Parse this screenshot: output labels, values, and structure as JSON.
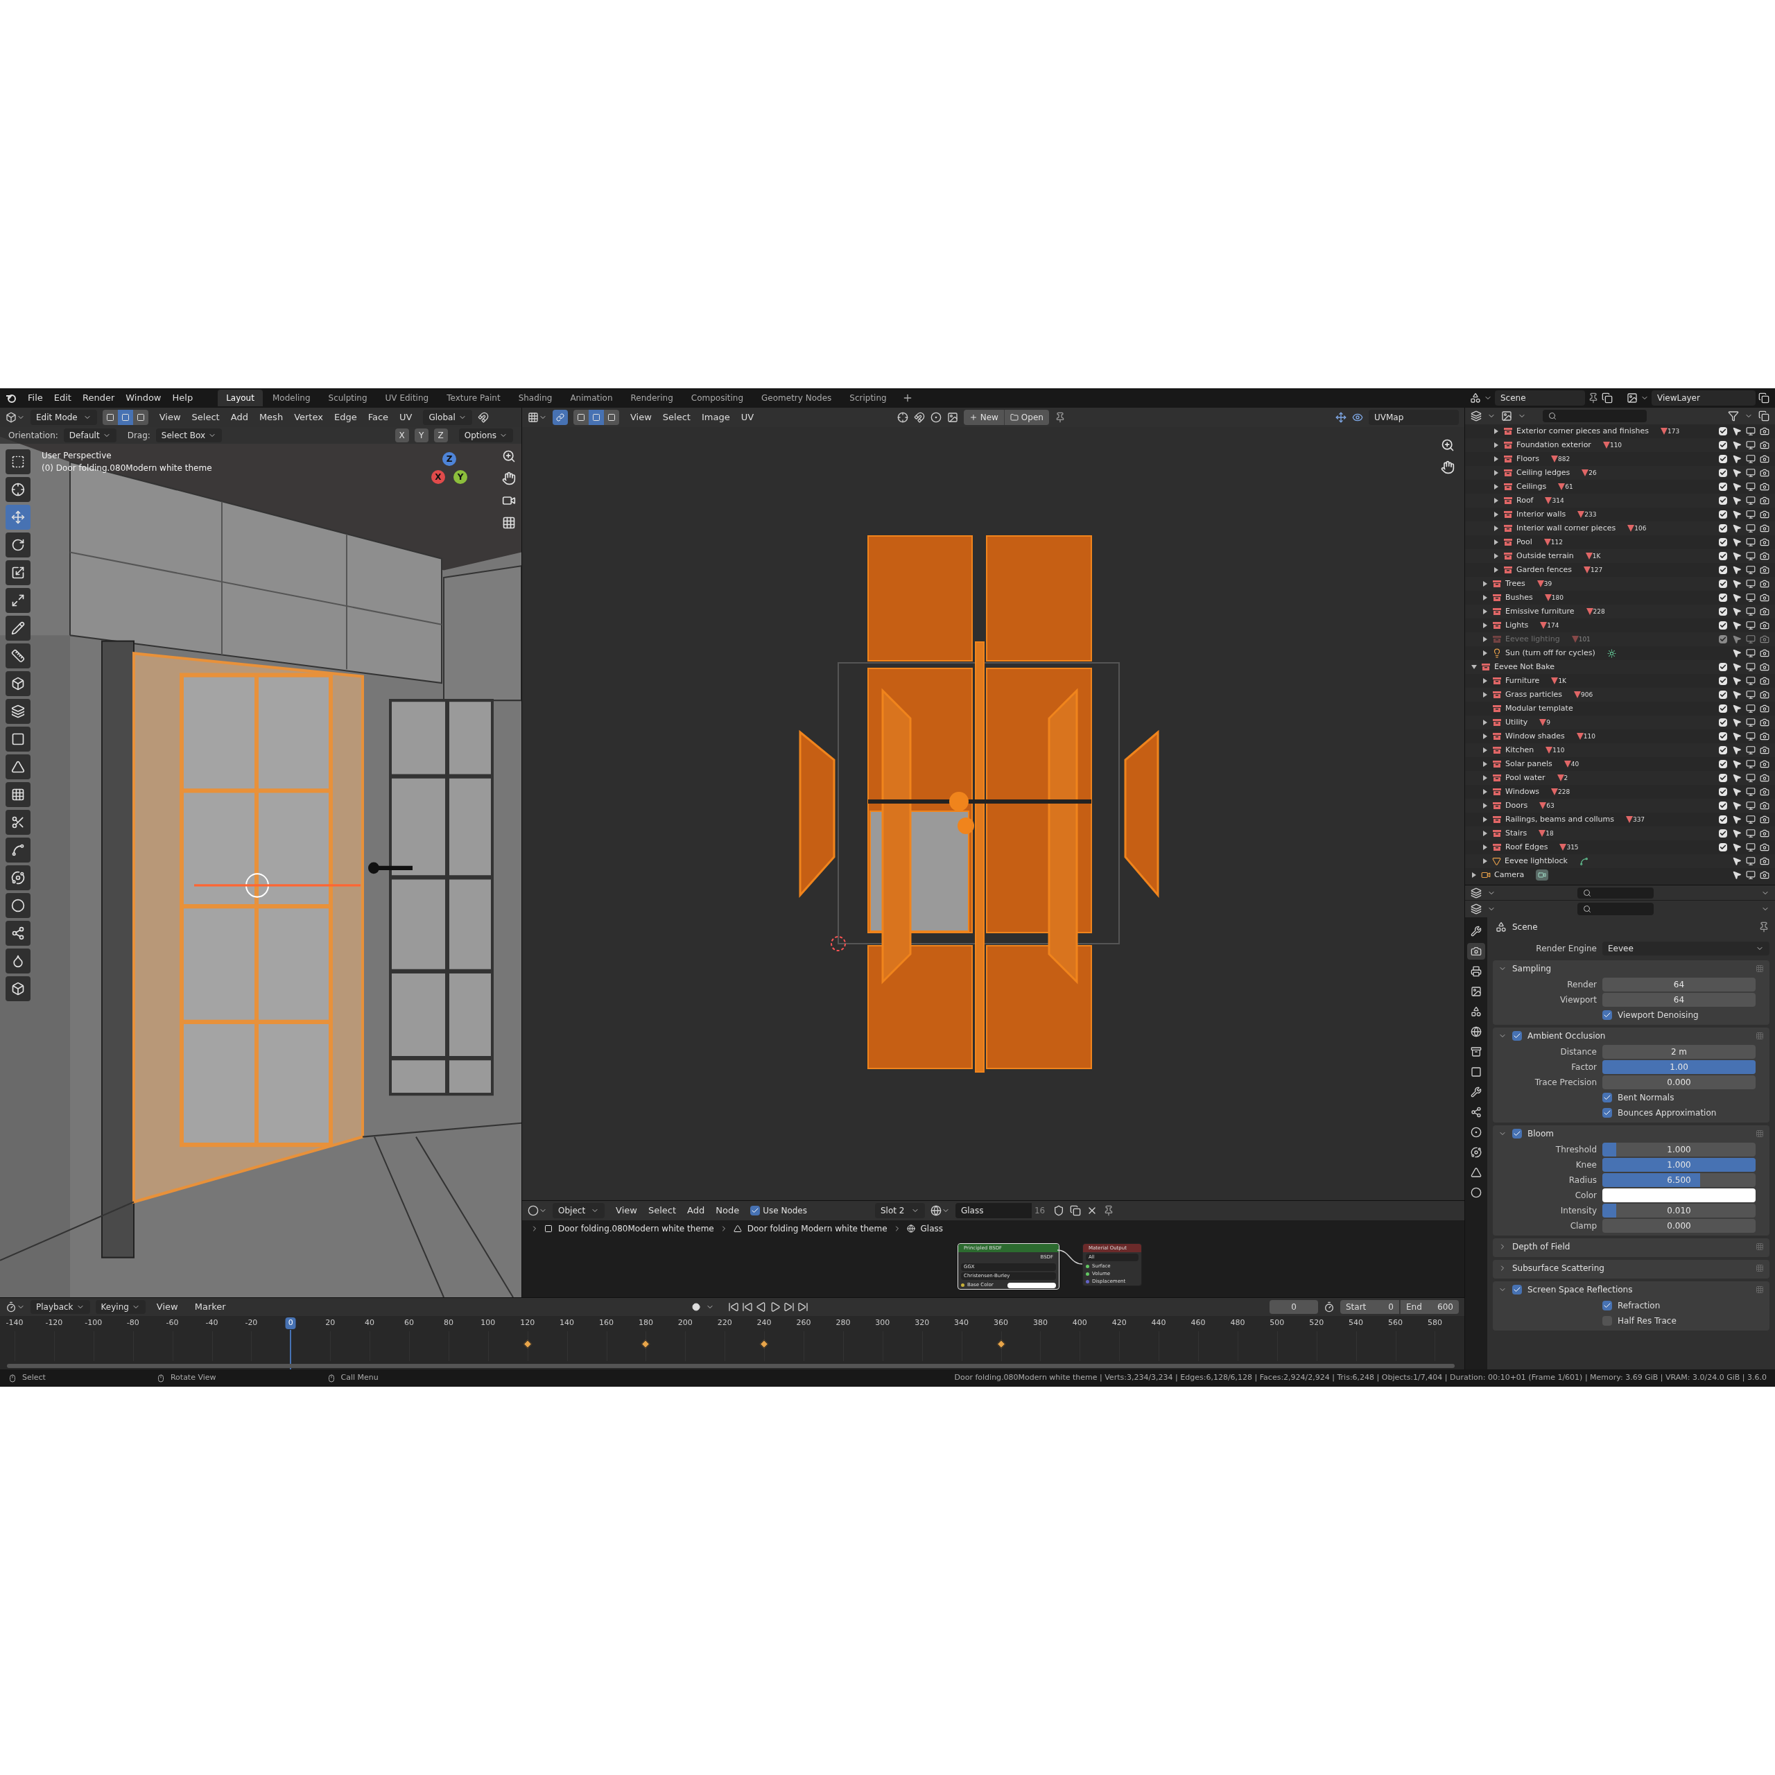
{
  "topbar": {
    "menus": [
      "File",
      "Edit",
      "Render",
      "Window",
      "Help"
    ],
    "workspaces": [
      {
        "label": "Layout",
        "selected": true
      },
      {
        "label": "Modeling",
        "selected": false
      },
      {
        "label": "Sculpting",
        "selected": false
      },
      {
        "label": "UV Editing",
        "selected": false
      },
      {
        "label": "Texture Paint",
        "selected": false
      },
      {
        "label": "Shading",
        "selected": false
      },
      {
        "label": "Animation",
        "selected": false
      },
      {
        "label": "Rendering",
        "selected": false
      },
      {
        "label": "Compositing",
        "selected": false
      },
      {
        "label": "Geometry Nodes",
        "selected": false
      },
      {
        "label": "Scripting",
        "selected": false
      }
    ],
    "scene": "Scene",
    "view_layer": "ViewLayer"
  },
  "viewport": {
    "mode": "Edit Mode",
    "select_modes": [
      {
        "selected": false
      },
      {
        "selected": true
      },
      {
        "selected": false
      }
    ],
    "menus": [
      "View",
      "Select",
      "Add",
      "Mesh",
      "Vertex",
      "Edge",
      "Face",
      "UV"
    ],
    "orientation": "Global",
    "orientation_label": "Orientation:",
    "orientation_default": "Default",
    "drag_label": "Drag:",
    "drag": "Select Box",
    "axes": [
      "X",
      "Y",
      "Z"
    ],
    "options": "Options",
    "overlay_lines": [
      "User Perspective",
      "(0) Door folding.080Modern white theme"
    ],
    "gizmo": [
      "X",
      "Y",
      "Z"
    ],
    "tools": [
      {
        "selected": false
      },
      {
        "selected": false
      },
      {
        "selected": true
      },
      {
        "selected": false
      },
      {
        "selected": false
      },
      {
        "selected": false
      },
      {
        "selected": false
      },
      {
        "selected": false
      },
      {
        "selected": false
      },
      {
        "selected": false
      },
      {
        "selected": false
      },
      {
        "selected": false
      },
      {
        "selected": false
      },
      {
        "selected": false
      },
      {
        "selected": false
      },
      {
        "selected": false
      },
      {
        "selected": false
      },
      {
        "selected": false
      },
      {
        "selected": false
      },
      {
        "selected": false
      }
    ]
  },
  "uv_editor": {
    "sync": true,
    "select_modes": [
      {
        "selected": false
      },
      {
        "selected": true
      },
      {
        "selected": false
      }
    ],
    "menus": [
      "View",
      "Select",
      "Image",
      "UV"
    ],
    "new": "New",
    "open": "Open",
    "uv_map": "UVMap"
  },
  "outliner": {
    "items": [
      {
        "children": [
          {
            "children": [
              {
                "name": "Exterior corner pieces and finishes",
                "count": "173",
                "kind": "collection",
                "expanded": false,
                "checked": true,
                "disabled": false
              },
              {
                "name": "Foundation exterior",
                "count": "110",
                "kind": "collection",
                "expanded": false,
                "checked": true,
                "disabled": false
              },
              {
                "name": "Floors",
                "count": "882",
                "kind": "collection",
                "expanded": false,
                "checked": true,
                "disabled": false
              },
              {
                "name": "Ceiling ledges",
                "count": "26",
                "kind": "collection",
                "expanded": false,
                "checked": true,
                "disabled": false
              },
              {
                "name": "Ceilings",
                "count": "61",
                "kind": "collection",
                "expanded": false,
                "checked": true,
                "disabled": false
              },
              {
                "name": "Roof",
                "count": "314",
                "kind": "collection",
                "expanded": false,
                "checked": true,
                "disabled": false
              },
              {
                "name": "Interior walls",
                "count": "233",
                "kind": "collection",
                "expanded": false,
                "checked": true,
                "disabled": false
              },
              {
                "name": "Interior wall corner pieces",
                "count": "106",
                "kind": "collection",
                "expanded": false,
                "checked": true,
                "disabled": false
              },
              {
                "name": "Pool",
                "count": "112",
                "kind": "collection",
                "expanded": false,
                "checked": true,
                "disabled": false
              },
              {
                "name": "Outside terrain",
                "count": "1K",
                "kind": "collection",
                "expanded": false,
                "checked": true,
                "disabled": false
              },
              {
                "name": "Garden fences",
                "count": "127",
                "kind": "collection",
                "expanded": false,
                "checked": true,
                "disabled": false
              }
            ]
          },
          {
            "name": "Trees",
            "count": "39",
            "kind": "collection",
            "expanded": false,
            "checked": true,
            "disabled": false
          },
          {
            "name": "Bushes",
            "count": "180",
            "kind": "collection",
            "expanded": false,
            "checked": true,
            "disabled": false
          },
          {
            "name": "Emissive furniture",
            "count": "228",
            "kind": "collection",
            "expanded": false,
            "checked": true,
            "disabled": false
          },
          {
            "name": "Lights",
            "count": "174",
            "kind": "collection",
            "expanded": false,
            "checked": true,
            "disabled": false
          },
          {
            "name": "Eevee lighting",
            "count": "101",
            "kind": "collection",
            "expanded": false,
            "checked": true,
            "disabled": true
          },
          {
            "name": "Sun (turn off for cycles)",
            "kind": "light",
            "expanded": false,
            "disabled": false
          }
        ]
      },
      {
        "name": "Eevee Not Bake",
        "kind": "collection",
        "expanded": true,
        "checked": true,
        "disabled": false,
        "children": [
          {
            "name": "Furniture",
            "count": "1K",
            "kind": "collection",
            "expanded": false,
            "checked": true,
            "disabled": false
          },
          {
            "name": "Grass particles",
            "count": "906",
            "kind": "collection",
            "expanded": false,
            "checked": true,
            "disabled": false
          },
          {
            "name": "Modular template",
            "kind": "collection",
            "checked": true,
            "disabled": false
          },
          {
            "name": "Utility",
            "count": "9",
            "kind": "collection",
            "expanded": false,
            "checked": true,
            "disabled": false
          },
          {
            "name": "Window shades",
            "count": "110",
            "kind": "collection",
            "expanded": false,
            "checked": true,
            "disabled": false
          },
          {
            "name": "Kitchen",
            "count": "110",
            "kind": "collection",
            "expanded": false,
            "checked": true,
            "disabled": false
          },
          {
            "name": "Solar panels",
            "count": "40",
            "kind": "collection",
            "expanded": false,
            "checked": true,
            "disabled": false
          },
          {
            "name": "Pool water",
            "count": "2",
            "kind": "collection",
            "expanded": false,
            "checked": true,
            "disabled": false
          },
          {
            "name": "Windows",
            "count": "228",
            "kind": "collection",
            "expanded": false,
            "checked": true,
            "disabled": false
          },
          {
            "name": "Doors",
            "count": "63",
            "kind": "collection",
            "expanded": false,
            "checked": true,
            "disabled": false
          },
          {
            "name": "Railings, beams and collums",
            "count": "337",
            "kind": "collection",
            "expanded": false,
            "checked": true,
            "disabled": false
          },
          {
            "name": "Stairs",
            "count": "18",
            "kind": "collection",
            "expanded": false,
            "checked": true,
            "disabled": false
          },
          {
            "name": "Roof Edges",
            "count": "315",
            "kind": "collection",
            "expanded": false,
            "checked": true,
            "disabled": false
          },
          {
            "name": "Eevee lightblock",
            "kind": "mesh",
            "expanded": false,
            "disabled": false
          }
        ]
      },
      {
        "name": "Camera",
        "kind": "camera",
        "expanded": false,
        "disabled": false
      }
    ]
  },
  "properties": {
    "tabs": [
      {
        "selected": false
      },
      {
        "selected": true
      },
      {
        "selected": false
      },
      {
        "selected": false
      },
      {
        "selected": false
      },
      {
        "selected": false
      },
      {
        "selected": false
      },
      {
        "selected": false
      },
      {
        "selected": false
      },
      {
        "selected": false
      },
      {
        "selected": false
      },
      {
        "selected": false
      },
      {
        "selected": false
      },
      {
        "selected": false
      }
    ],
    "context": "Scene",
    "render_engine_label": "Render Engine",
    "render_engine": "Eevee",
    "panels": [
      {
        "title": "Sampling",
        "expanded": true,
        "rows": [
          {
            "kind": "number",
            "label": "Render",
            "value": "64"
          },
          {
            "kind": "number",
            "label": "Viewport",
            "value": "64"
          },
          {
            "kind": "check",
            "label": "Viewport Denoising",
            "checked": true
          }
        ]
      },
      {
        "title": "Ambient Occlusion",
        "checked": true,
        "expanded": true,
        "rows": [
          {
            "kind": "number",
            "label": "Distance",
            "value": "2 m"
          },
          {
            "kind": "slider",
            "label": "Factor",
            "value": "1.00",
            "level": 1
          },
          {
            "kind": "number",
            "label": "Trace Precision",
            "value": "0.000"
          },
          {
            "kind": "check",
            "label": "Bent Normals",
            "checked": true
          },
          {
            "kind": "check",
            "label": "Bounces Approximation",
            "checked": true
          }
        ]
      },
      {
        "title": "Bloom",
        "checked": true,
        "expanded": true,
        "rows": [
          {
            "kind": "slider",
            "label": "Threshold",
            "value": "1.000",
            "level": 0.09
          },
          {
            "kind": "slider",
            "label": "Knee",
            "value": "1.000",
            "level": 1
          },
          {
            "kind": "slider",
            "label": "Radius",
            "value": "6.500",
            "level": 0.64
          },
          {
            "kind": "color",
            "label": "Color",
            "color": "#ffffff"
          },
          {
            "kind": "slider",
            "label": "Intensity",
            "value": "0.010",
            "level": 0.09
          },
          {
            "kind": "number",
            "label": "Clamp",
            "value": "0.000"
          }
        ]
      },
      {
        "title": "Depth of Field",
        "expanded": false
      },
      {
        "title": "Subsurface Scattering",
        "expanded": false
      },
      {
        "title": "Screen Space Reflections",
        "checked": true,
        "expanded": true,
        "rows": [
          {
            "kind": "check",
            "label": "Refraction",
            "checked": true
          },
          {
            "kind": "check",
            "label": "Half Res Trace",
            "checked": false
          }
        ]
      }
    ]
  },
  "node_editor": {
    "object_mode": "Object",
    "menus": [
      "View",
      "Select",
      "Add",
      "Node"
    ],
    "use_nodes": {
      "label": "Use Nodes",
      "checked": true
    },
    "slot": "Slot 2",
    "material": "Glass",
    "users": "16",
    "breadcrumbs": [
      "Door folding.080Modern white theme",
      "Door folding Modern white theme",
      "Glass"
    ],
    "nodes": [
      {
        "kind": "bsdf",
        "title": "Principled BSDF",
        "output": "BSDF",
        "dropdowns": [
          "GGX",
          "Christensen-Burley"
        ],
        "inputs": [
          "Base Color"
        ]
      },
      {
        "kind": "output",
        "title": "Material Output",
        "dropdowns": [
          "All"
        ],
        "inputs": [
          "Surface",
          "Volume",
          "Displacement"
        ]
      }
    ]
  },
  "timeline": {
    "menus": [
      {
        "label": "Playback",
        "kind": "dropdown"
      },
      {
        "label": "Keying",
        "kind": "dropdown"
      },
      {
        "label": "View",
        "kind": "menu"
      },
      {
        "label": "Marker",
        "kind": "menu"
      }
    ],
    "current_frame": "0",
    "start_label": "Start",
    "start": "0",
    "end_label": "End",
    "end": "600",
    "ticks": [
      {
        "label": "-140",
        "selected": false,
        "keyframe": false
      },
      {
        "label": "-120",
        "selected": false,
        "keyframe": false
      },
      {
        "label": "-100",
        "selected": false,
        "keyframe": false
      },
      {
        "label": "-80",
        "selected": false,
        "keyframe": false
      },
      {
        "label": "-60",
        "selected": false,
        "keyframe": false
      },
      {
        "label": "-40",
        "selected": false,
        "keyframe": false
      },
      {
        "label": "-20",
        "selected": false,
        "keyframe": false
      },
      {
        "label": "0",
        "selected": true,
        "keyframe": false
      },
      {
        "label": "20",
        "selected": false,
        "keyframe": false
      },
      {
        "label": "40",
        "selected": false,
        "keyframe": false
      },
      {
        "label": "60",
        "selected": false,
        "keyframe": false
      },
      {
        "label": "80",
        "selected": false,
        "keyframe": false
      },
      {
        "label": "100",
        "selected": false,
        "keyframe": false
      },
      {
        "label": "120",
        "selected": false,
        "keyframe": true
      },
      {
        "label": "140",
        "selected": false,
        "keyframe": false
      },
      {
        "label": "160",
        "selected": false,
        "keyframe": false
      },
      {
        "label": "180",
        "selected": false,
        "keyframe": true
      },
      {
        "label": "200",
        "selected": false,
        "keyframe": false
      },
      {
        "label": "220",
        "selected": false,
        "keyframe": false
      },
      {
        "label": "240",
        "selected": false,
        "keyframe": true
      },
      {
        "label": "260",
        "selected": false,
        "keyframe": false
      },
      {
        "label": "280",
        "selected": false,
        "keyframe": false
      },
      {
        "label": "300",
        "selected": false,
        "keyframe": false
      },
      {
        "label": "320",
        "selected": false,
        "keyframe": false
      },
      {
        "label": "340",
        "selected": false,
        "keyframe": false
      },
      {
        "label": "360",
        "selected": false,
        "keyframe": true
      },
      {
        "label": "380",
        "selected": false,
        "keyframe": false
      },
      {
        "label": "400",
        "selected": false,
        "keyframe": false
      },
      {
        "label": "420",
        "selected": false,
        "keyframe": false
      },
      {
        "label": "440",
        "selected": false,
        "keyframe": false
      },
      {
        "label": "460",
        "selected": false,
        "keyframe": false
      },
      {
        "label": "480",
        "selected": false,
        "keyframe": false
      },
      {
        "label": "500",
        "selected": false,
        "keyframe": false
      },
      {
        "label": "520",
        "selected": false,
        "keyframe": false
      },
      {
        "label": "540",
        "selected": false,
        "keyframe": false
      },
      {
        "label": "560",
        "selected": false,
        "keyframe": false
      },
      {
        "label": "580",
        "selected": false,
        "keyframe": false
      }
    ]
  },
  "status_bar": {
    "hints": [
      "Select",
      "Rotate View",
      "Call Menu"
    ],
    "stats": "Door folding.080Modern white theme | Verts:3,234/3,234 | Edges:6,128/6,128 | Faces:2,924/2,924 | Tris:6,248 | Objects:1/7,404 | Duration: 00:10+01 (Frame 1/601) | Memory: 3.69 GiB | VRAM: 3.0/24.0 GiB | 3.6.0"
  }
}
